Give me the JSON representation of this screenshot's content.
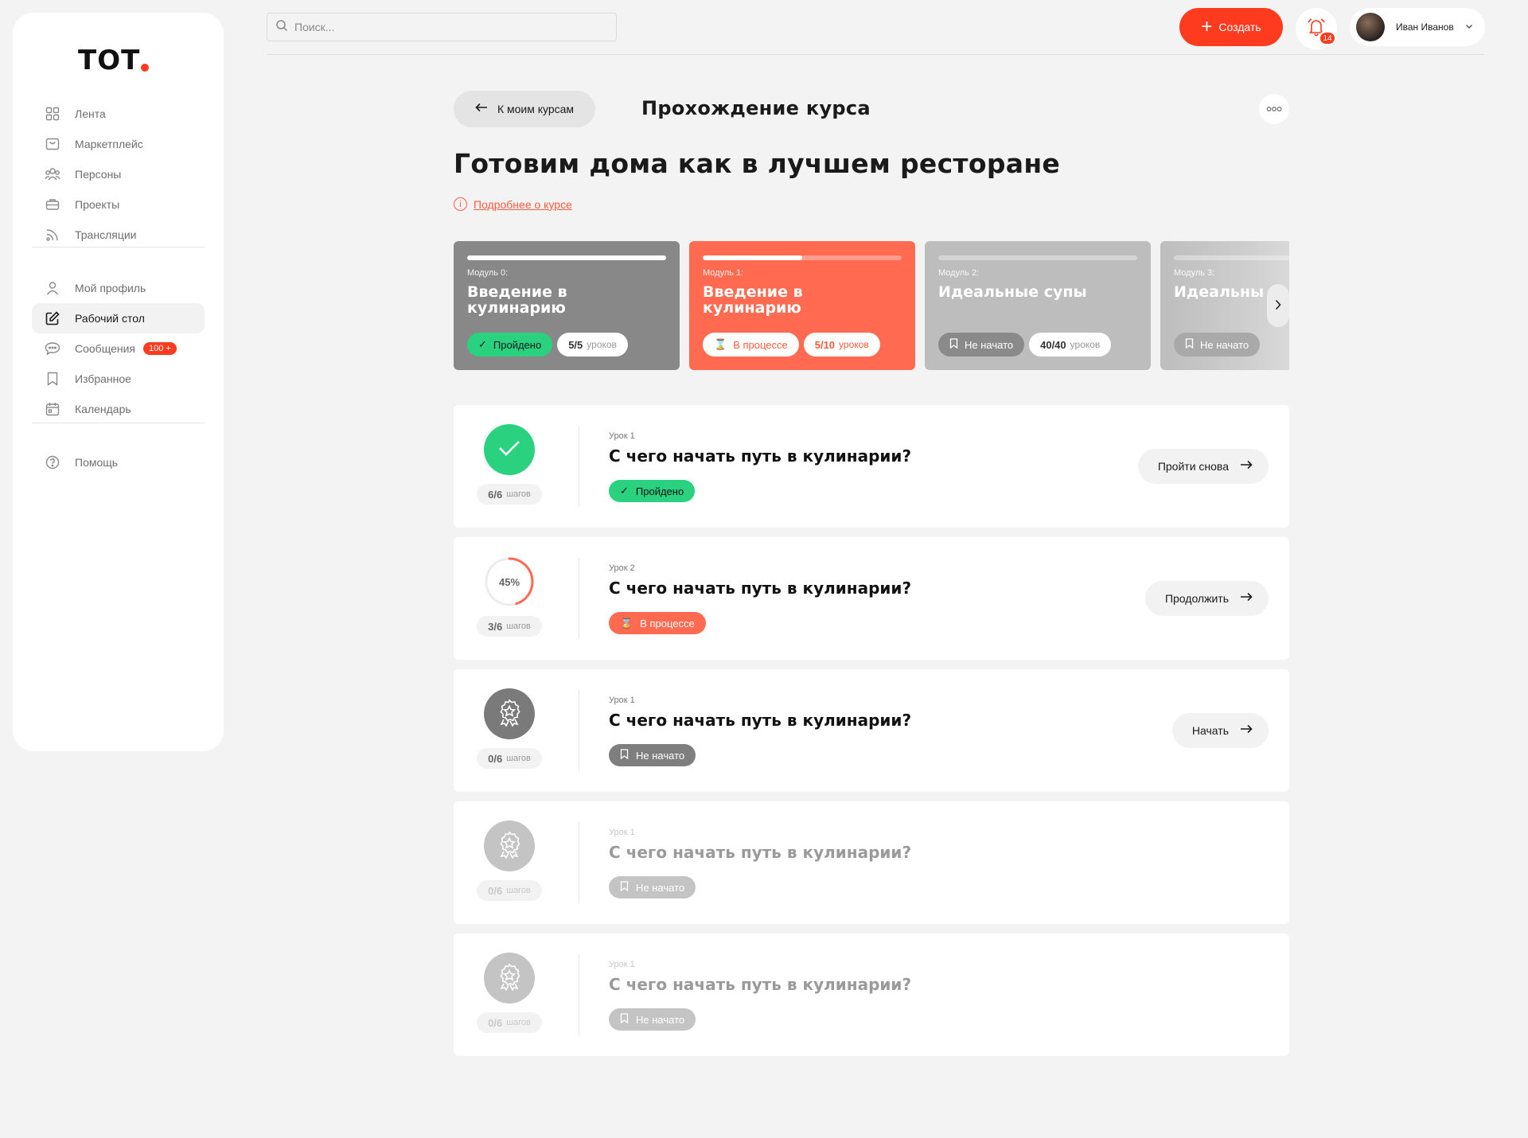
{
  "colors": {
    "accent": "#ff3b1f",
    "accent_soft": "#ff6a50",
    "success": "#2ad17e",
    "neutral": "#888888",
    "page_bg": "#f3f3f3"
  },
  "logo": {
    "text": "ТОТ"
  },
  "sidebar": {
    "primary": [
      {
        "label": "Лента",
        "icon": "grid-icon"
      },
      {
        "label": "Маркетплейс",
        "icon": "shop-icon"
      },
      {
        "label": "Персоны",
        "icon": "people-icon"
      },
      {
        "label": "Проекты",
        "icon": "briefcase-icon"
      },
      {
        "label": "Трансляции",
        "icon": "broadcast-icon"
      }
    ],
    "secondary": [
      {
        "label": "Мой профиль",
        "icon": "user-icon"
      },
      {
        "label": "Рабочий стол",
        "icon": "edit-icon",
        "active": true
      },
      {
        "label": "Сообщения",
        "icon": "chat-icon",
        "badge": "100 +"
      },
      {
        "label": "Избранное",
        "icon": "bookmark-icon"
      },
      {
        "label": "Календарь",
        "icon": "calendar-icon"
      }
    ],
    "help": {
      "label": "Помощь",
      "icon": "help-icon"
    }
  },
  "header": {
    "search_placeholder": "Поиск...",
    "create_label": "Создать",
    "notifications_count": "14",
    "user_name": "Иван Иванов"
  },
  "page": {
    "back_label": "К моим курсам",
    "heading": "Прохождение курса",
    "course_title": "Готовим дома как в лучшем ресторане",
    "course_link": "Подробнее о курсе"
  },
  "modules": [
    {
      "label": "Модуль 0:",
      "title": "Введение в кулинарию",
      "progress": 1.0,
      "status": "Пройдено",
      "lessons": "5/5",
      "lessons_unit": "уроков"
    },
    {
      "label": "Модуль 1:",
      "title": "Введение в кулинарию",
      "progress": 0.5,
      "status": "В процессе",
      "lessons": "5/10",
      "lessons_unit": "уроков"
    },
    {
      "label": "Модуль 2:",
      "title": "Идеальные супы",
      "progress": 0.0,
      "status": "Не начато",
      "lessons": "40/40",
      "lessons_unit": "уроков"
    },
    {
      "label": "Модуль 3:",
      "title": "Идеальны",
      "progress": 0.0,
      "status": "Не начато",
      "lessons": "",
      "lessons_unit": ""
    }
  ],
  "lessons": [
    {
      "label": "Урок 1",
      "title": "С чего начать путь в кулинарии?",
      "steps": "6/6",
      "steps_unit": "шагов",
      "status": "Пройдено",
      "action": "Пройти снова",
      "progress_text": ""
    },
    {
      "label": "Урок 2",
      "title": "С чего начать путь в кулинарии?",
      "steps": "3/6",
      "steps_unit": "шагов",
      "status": "В процессе",
      "action": "Продолжить",
      "progress_text": "45%",
      "progress": 0.45
    },
    {
      "label": "Урок 1",
      "title": "С чего начать путь в кулинарии?",
      "steps": "0/6",
      "steps_unit": "шагов",
      "status": "Не начато",
      "action": "Начать",
      "progress_text": ""
    },
    {
      "label": "Урок 1",
      "title": "С чего начать путь в кулинарии?",
      "steps": "0/6",
      "steps_unit": "шагов",
      "status": "Не начато",
      "action": "",
      "progress_text": ""
    },
    {
      "label": "Урок 1",
      "title": "С чего начать путь в кулинарии?",
      "steps": "0/6",
      "steps_unit": "шагов",
      "status": "Не начато",
      "action": "",
      "progress_text": ""
    }
  ]
}
